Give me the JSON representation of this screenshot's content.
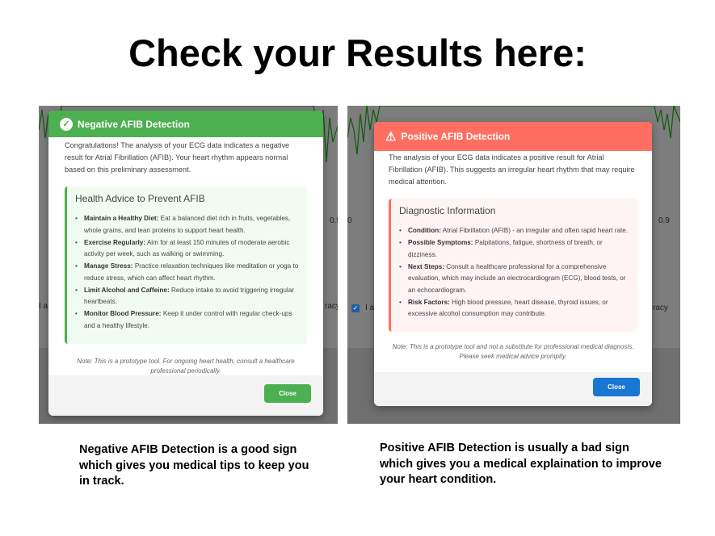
{
  "heading": "Check your Results here:",
  "negative": {
    "title": "Negative AFIB Detection",
    "intro": "Congratulations! The analysis of your ECG data indicates a negative result for Atrial Fibrillation (AFIB). Your heart rhythm appears normal based on this preliminary assessment.",
    "box_title": "Health Advice to Prevent AFIB",
    "items": [
      {
        "label": "Maintain a Healthy Diet:",
        "text": "Eat a balanced diet rich in fruits, vegetables, whole grains, and lean proteins to support heart health."
      },
      {
        "label": "Exercise Regularly:",
        "text": "Aim for at least 150 minutes of moderate aerobic activity per week, such as walking or swimming."
      },
      {
        "label": "Manage Stress:",
        "text": "Practice relaxation techniques like meditation or yoga to reduce stress, which can affect heart rhythm."
      },
      {
        "label": "Limit Alcohol and Caffeine:",
        "text": "Reduce intake to avoid triggering irregular heartbeats."
      },
      {
        "label": "Monitor Blood Pressure:",
        "text": "Keep it under control with regular check-ups and a healthy lifestyle."
      }
    ],
    "note": "Note: This is a prototype tool. For ongoing heart health, consult a healthcare professional periodically.",
    "close": "Close",
    "bg_axis": "0.9",
    "bg_left": "I a",
    "bg_right": "racy",
    "color": "#4caf50"
  },
  "positive": {
    "title": "Positive AFIB Detection",
    "intro": "The analysis of your ECG data indicates a positive result for Atrial Fibrillation (AFIB). This suggests an irregular heart rhythm that may require medical attention.",
    "box_title": "Diagnostic Information",
    "items": [
      {
        "label": "Condition:",
        "text": "Atrial Fibrillation (AFIB) - an irregular and often rapid heart rate."
      },
      {
        "label": "Possible Symptoms:",
        "text": "Palpitations, fatigue, shortness of breath, or dizziness."
      },
      {
        "label": "Next Steps:",
        "text": "Consult a healthcare professional for a comprehensive evaluation, which may include an electrocardiogram (ECG), blood tests, or an echocardiogram."
      },
      {
        "label": "Risk Factors:",
        "text": "High blood pressure, heart disease, thyroid issues, or excessive alcohol consumption may contribute."
      }
    ],
    "note": "Note: This is a prototype tool and not a substitute for professional medical diagnosis. Please seek medical advice promptly.",
    "close": "Close",
    "bg_axis_left": "0",
    "bg_axis": "0.9",
    "bg_left": "I a",
    "bg_right": "racy",
    "color": "#ff6f61"
  },
  "captions": {
    "negative": "Negative AFIB Detection is a good sign which gives you medical tips to keep you in track.",
    "positive": "Positive AFIB Detection is usually a bad sign which gives you a medical explaination to improve your heart condition."
  }
}
